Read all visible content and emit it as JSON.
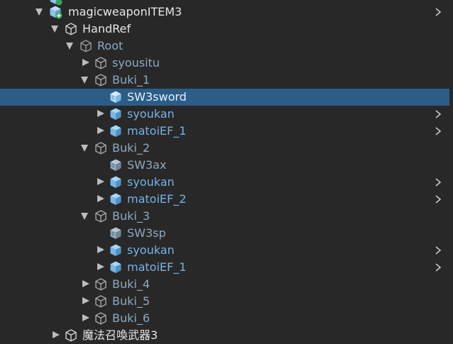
{
  "hierarchy": {
    "items": [
      {
        "label": "magicweaponITEM3"
      },
      {
        "label": "HandRef"
      },
      {
        "label": "Root"
      },
      {
        "label": "syousitu"
      },
      {
        "label": "Buki_1"
      },
      {
        "label": "SW3sword"
      },
      {
        "label": "syoukan"
      },
      {
        "label": "matoiEF_1"
      },
      {
        "label": "Buki_2"
      },
      {
        "label": "SW3ax"
      },
      {
        "label": "syoukan"
      },
      {
        "label": "matoiEF_2"
      },
      {
        "label": "Buki_3"
      },
      {
        "label": "SW3sp"
      },
      {
        "label": "syoukan"
      },
      {
        "label": "matoiEF_1"
      },
      {
        "label": "Buki_4"
      },
      {
        "label": "Buki_5"
      },
      {
        "label": "Buki_6"
      },
      {
        "label": "魔法召喚武器3"
      }
    ]
  },
  "colors": {
    "background": "#282828",
    "selection": "#2c5d87",
    "prefab_blue": "#7ab2e6",
    "text_white": "#e6e6e6"
  }
}
